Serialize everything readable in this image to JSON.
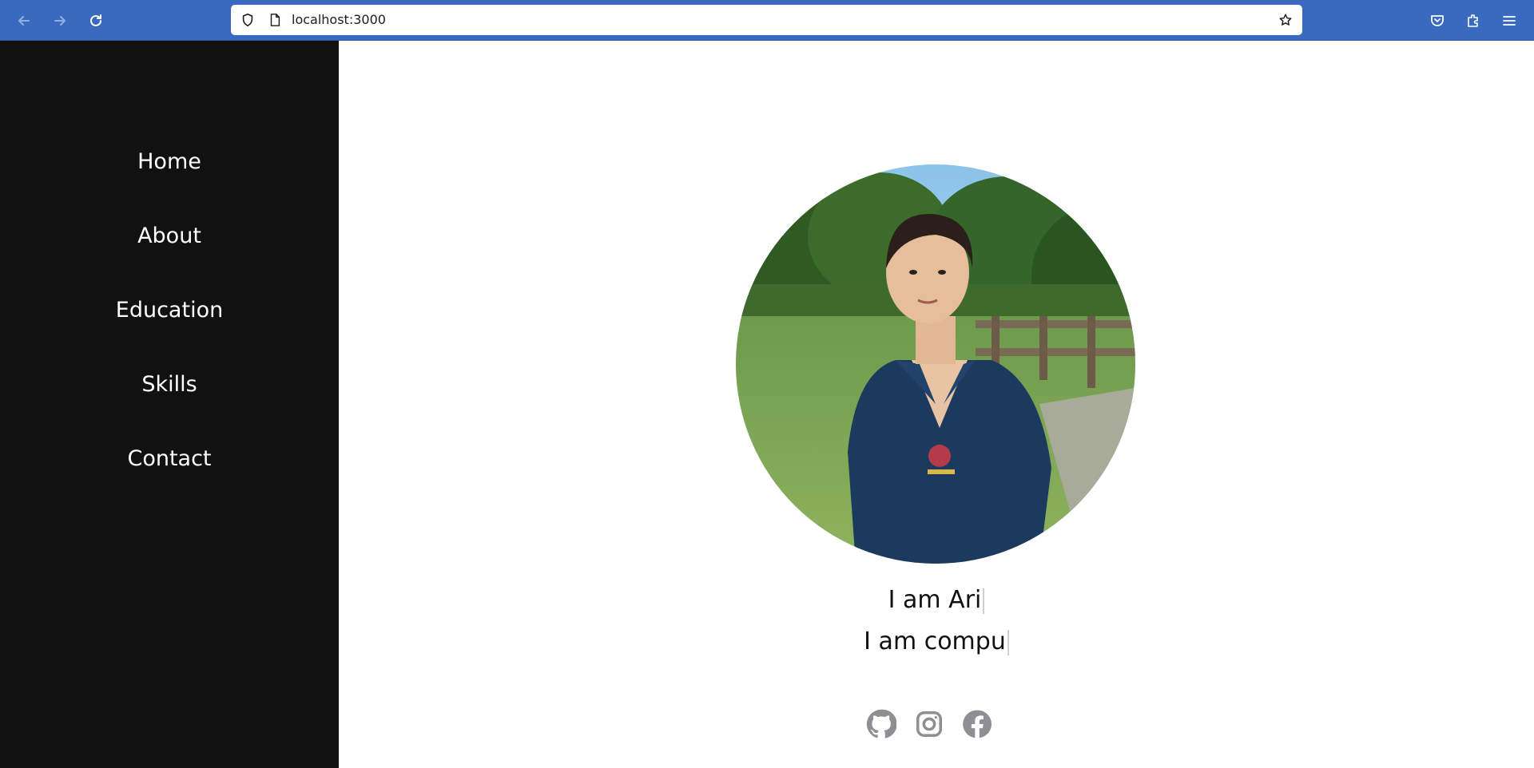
{
  "browser": {
    "url": "localhost:3000",
    "accent": "#3a6ac0"
  },
  "sidebar": {
    "background": "#111111",
    "items": [
      {
        "label": "Home"
      },
      {
        "label": "About"
      },
      {
        "label": "Education"
      },
      {
        "label": "Skills"
      },
      {
        "label": "Contact"
      }
    ]
  },
  "profile": {
    "photo_icon": "profile-photo",
    "typed_line_1": "I am Ari",
    "typed_line_2": "I am compu"
  },
  "socials": [
    {
      "icon": "github-icon"
    },
    {
      "icon": "instagram-icon"
    },
    {
      "icon": "facebook-icon"
    }
  ]
}
